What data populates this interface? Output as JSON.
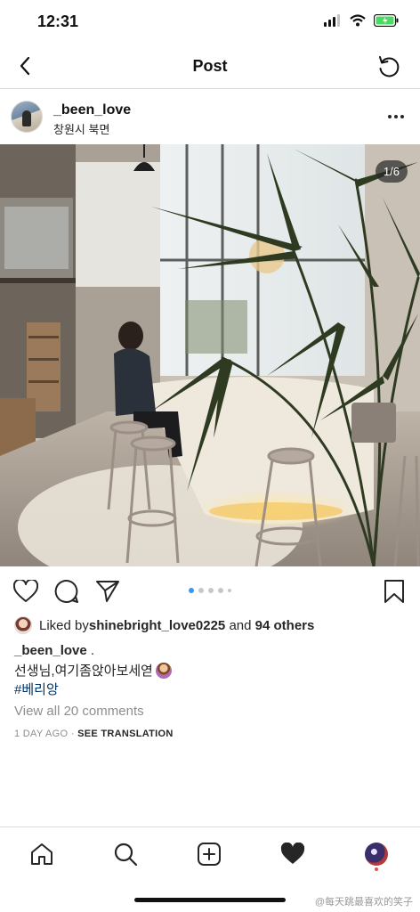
{
  "status_bar": {
    "time": "12:31"
  },
  "nav": {
    "title": "Post"
  },
  "post": {
    "username": "_been_love",
    "location": "창원시 북면",
    "photo_counter": "1/6",
    "carousel": {
      "total": 6,
      "current": 1
    },
    "likes": {
      "prefix": "Liked by ",
      "user": "shinebright_love0225",
      "middle": " and ",
      "others": "94 others"
    },
    "caption": {
      "username": "_been_love",
      "suffix": " .",
      "text": "선생님,여기좀앉아보세엳",
      "hashtag": "#베리앙"
    },
    "view_comments": "View all 20 comments",
    "time_ago": "1 DAY AGO",
    "separator": " · ",
    "see_translation": "SEE TRANSLATION"
  },
  "watermark": "@每天跳最喜欢的笑子",
  "colors": {
    "link": "#003569",
    "muted": "#8e8e8e",
    "carousel_active": "#3897f0",
    "battery": "#4cd964"
  },
  "icons": {
    "nav": [
      "back-chevron-icon",
      "refresh-icon"
    ],
    "post": [
      "heart-icon",
      "comment-icon",
      "share-icon",
      "bookmark-icon",
      "more-icon"
    ],
    "tabbar": [
      "home-icon",
      "search-icon",
      "add-icon",
      "activity-heart-icon",
      "profile-avatar-icon"
    ]
  }
}
